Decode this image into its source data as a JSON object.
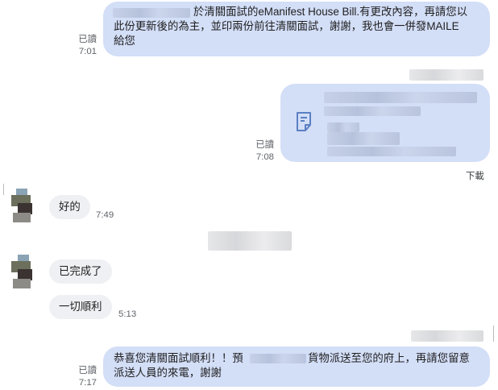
{
  "messages": {
    "m1": {
      "text_a": "於清關面試的eManifest House Bill.有更改內容，再請您以",
      "text_b": "此份更新後的為主，並印兩份前往清關面試，謝謝，我也會一併發MAILE",
      "text_c": "給您",
      "status": "已讀",
      "time": "7:01"
    },
    "m2": {
      "status": "已讀",
      "time": "7:08",
      "action": "下載",
      "icon": "document-icon"
    },
    "m3": {
      "text": "好的",
      "time": "7:49"
    },
    "m4": {
      "text": "已完成了"
    },
    "m5": {
      "text": "一切順利",
      "time": "5:13"
    },
    "m6": {
      "text_a": "恭喜您清關面試順利！！預",
      "text_b": "貨物派送至您的府上，再請您留意",
      "text_c": "派送人員的來電，謝謝",
      "status": "已讀",
      "time": "7:17"
    }
  },
  "colors": {
    "outgoing_bubble": "#d3def7",
    "incoming_bubble": "#eef0f3",
    "meta_text": "#5f6368",
    "file_icon": "#5b7fc2"
  }
}
